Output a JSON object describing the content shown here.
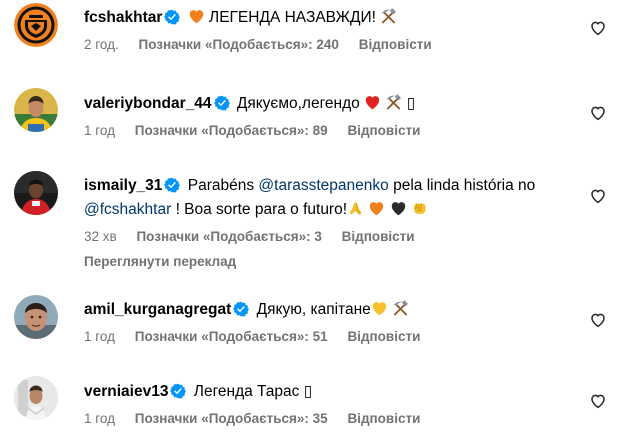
{
  "comments": [
    {
      "username": "fcshakhtar",
      "text": "ЛЕГЕНДА НАЗАВЖДИ!",
      "time": "2 год.",
      "likes": "Позначки «Подобається»: 240",
      "reply": "Відповісти"
    },
    {
      "username": "valeriybondar_44",
      "text": "Дякуємо,легендо",
      "trailing_glyph": "▯",
      "time": "1 год",
      "likes": "Позначки «Подобається»: 89",
      "reply": "Відповісти"
    },
    {
      "username": "ismaily_31",
      "text_before": "Parabéns",
      "mention1": "@tarasstepanenko",
      "text_middle": "pela linda história no",
      "mention2": "@fcshakhtar",
      "text_after": "! Boa sorte para o futuro!",
      "time": "32 хв",
      "likes": "Позначки «Подобається»: 3",
      "reply": "Відповісти",
      "translate": "Переглянути переклад"
    },
    {
      "username": "amil_kurganagregat",
      "text": "Дякую, капітане",
      "time": "1 год",
      "likes": "Позначки «Подобається»: 51",
      "reply": "Відповісти"
    },
    {
      "username": "verniaiev13",
      "text": "Легенда Тарас",
      "trailing_glyph": "▯",
      "time": "1 год",
      "likes": "Позначки «Подобається»: 35",
      "reply": "Відповісти"
    }
  ],
  "colors": {
    "verified": "#0095f6",
    "meta_text": "#737373",
    "mention": "#00376b",
    "heart_orange": "#f3801f",
    "heart_red": "#e0241f",
    "heart_black": "#2b2b2b",
    "emoji_yellow": "#f6c02b"
  },
  "icons": {
    "verified": "verified-badge-icon",
    "like": "heart-outline-icon",
    "hammer_pick": "hammer-and-pick-icon",
    "orange_heart": "orange-heart-icon",
    "red_heart": "red-heart-icon",
    "black_heart": "black-heart-icon",
    "pray": "folded-hands-icon",
    "fist": "oncoming-fist-icon",
    "yellow_heart": "yellow-heart-icon"
  }
}
